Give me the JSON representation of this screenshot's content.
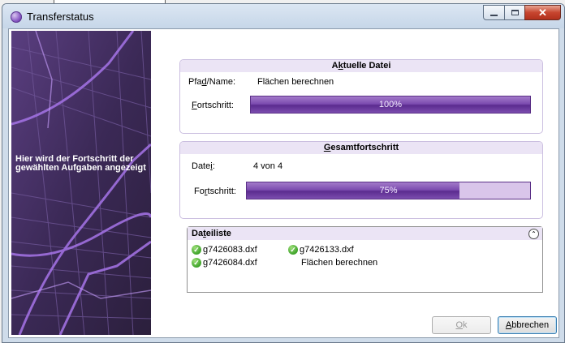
{
  "window": {
    "title": "Transferstatus"
  },
  "banner": {
    "text": "Hier wird der Fortschritt der gewählten Aufgaben angezeigt"
  },
  "current_file": {
    "header_pre": "A",
    "header_ul": "k",
    "header_post": "tuelle Datei",
    "path_label_pre": "Pfa",
    "path_label_ul": "d",
    "path_label_post": "/Name:",
    "path_value": "Flächen berechnen",
    "progress_label_pre": "",
    "progress_label_ul": "F",
    "progress_label_post": "ortschritt:",
    "progress_value": 1.0,
    "progress_text": "100%"
  },
  "overall": {
    "header_pre": "",
    "header_ul": "G",
    "header_post": "esamtfortschritt",
    "file_label_pre": "Date",
    "file_label_ul": "i",
    "file_label_post": ":",
    "file_value": "4 von 4",
    "progress_label_pre": "Fo",
    "progress_label_ul": "r",
    "progress_label_post": "tschritt:",
    "progress_value": 0.75,
    "progress_text": "75%"
  },
  "file_list": {
    "header_pre": "Da",
    "header_ul": "t",
    "header_post": "eiliste",
    "collapse_icon": "chevron-up-icon",
    "items": [
      {
        "name": "g7426083.dxf",
        "icon": "check-icon"
      },
      {
        "name": "g7426133.dxf",
        "icon": "check-icon"
      },
      {
        "name": "g7426084.dxf",
        "icon": "check-icon"
      },
      {
        "name": "Flächen berechnen",
        "icon": ""
      }
    ]
  },
  "buttons": {
    "ok_pre": "",
    "ok_ul": "O",
    "ok_post": "k",
    "cancel_pre": "",
    "cancel_ul": "A",
    "cancel_post": "bbrechen"
  },
  "colors": {
    "accent_purple": "#6b3aa0",
    "panel_header": "#ebe4f5",
    "check_green": "#3fa32a"
  }
}
